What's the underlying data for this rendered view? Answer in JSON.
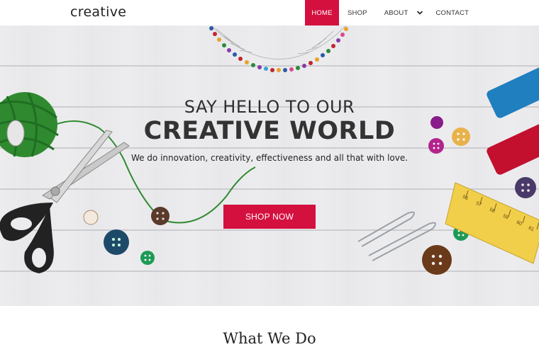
{
  "header": {
    "logo": "creative",
    "nav": [
      {
        "label": "HOME"
      },
      {
        "label": "SHOP"
      },
      {
        "label": "ABOUT"
      },
      {
        "label": "CONTACT"
      }
    ]
  },
  "hero": {
    "title_line1": "SAY HELLO TO OUR",
    "title_line2": "CREATIVE WORLD",
    "subtitle": "We do innovation, creativity, effectiveness and all that with love.",
    "cta": "SHOP NOW",
    "ruler_numbers": [
      "56",
      "57",
      "58",
      "59",
      "60",
      "61"
    ]
  },
  "section": {
    "title": "What We Do"
  },
  "colors": {
    "accent": "#d4103f",
    "text": "#222222"
  }
}
